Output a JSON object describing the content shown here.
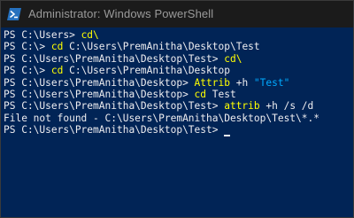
{
  "window": {
    "title": "Administrator: Windows PowerShell",
    "icon": "powershell-icon"
  },
  "colors": {
    "background": "#012456",
    "text": "#eeedf0",
    "command": "#ffff00",
    "string": "#00aaff",
    "titlebar": "#1b1b1b"
  },
  "console": {
    "lines": [
      {
        "prompt": "PS C:\\Users> ",
        "cmd": "cd\\",
        "args": "",
        "str": ""
      },
      {
        "prompt": "PS C:\\> ",
        "cmd": "cd",
        "args": " C:\\Users\\PremAnitha\\Desktop\\Test",
        "str": ""
      },
      {
        "prompt": "PS C:\\Users\\PremAnitha\\Desktop\\Test> ",
        "cmd": "cd\\",
        "args": "",
        "str": ""
      },
      {
        "prompt": "PS C:\\> ",
        "cmd": "cd",
        "args": " C:\\Users\\PremAnitha\\Desktop",
        "str": ""
      },
      {
        "prompt": "PS C:\\Users\\PremAnitha\\Desktop> ",
        "cmd": "Attrib",
        "args": " +h ",
        "str": "\"Test\""
      },
      {
        "prompt": "PS C:\\Users\\PremAnitha\\Desktop> ",
        "cmd": "cd",
        "args": " Test",
        "str": ""
      },
      {
        "prompt": "PS C:\\Users\\PremAnitha\\Desktop\\Test> ",
        "cmd": "attrib",
        "args": " +h /s /d",
        "str": ""
      },
      {
        "output": "File not found - C:\\Users\\PremAnitha\\Desktop\\Test\\*.*"
      },
      {
        "prompt": "PS C:\\Users\\PremAnitha\\Desktop\\Test> ",
        "cmd": "",
        "args": "",
        "str": ""
      }
    ]
  }
}
